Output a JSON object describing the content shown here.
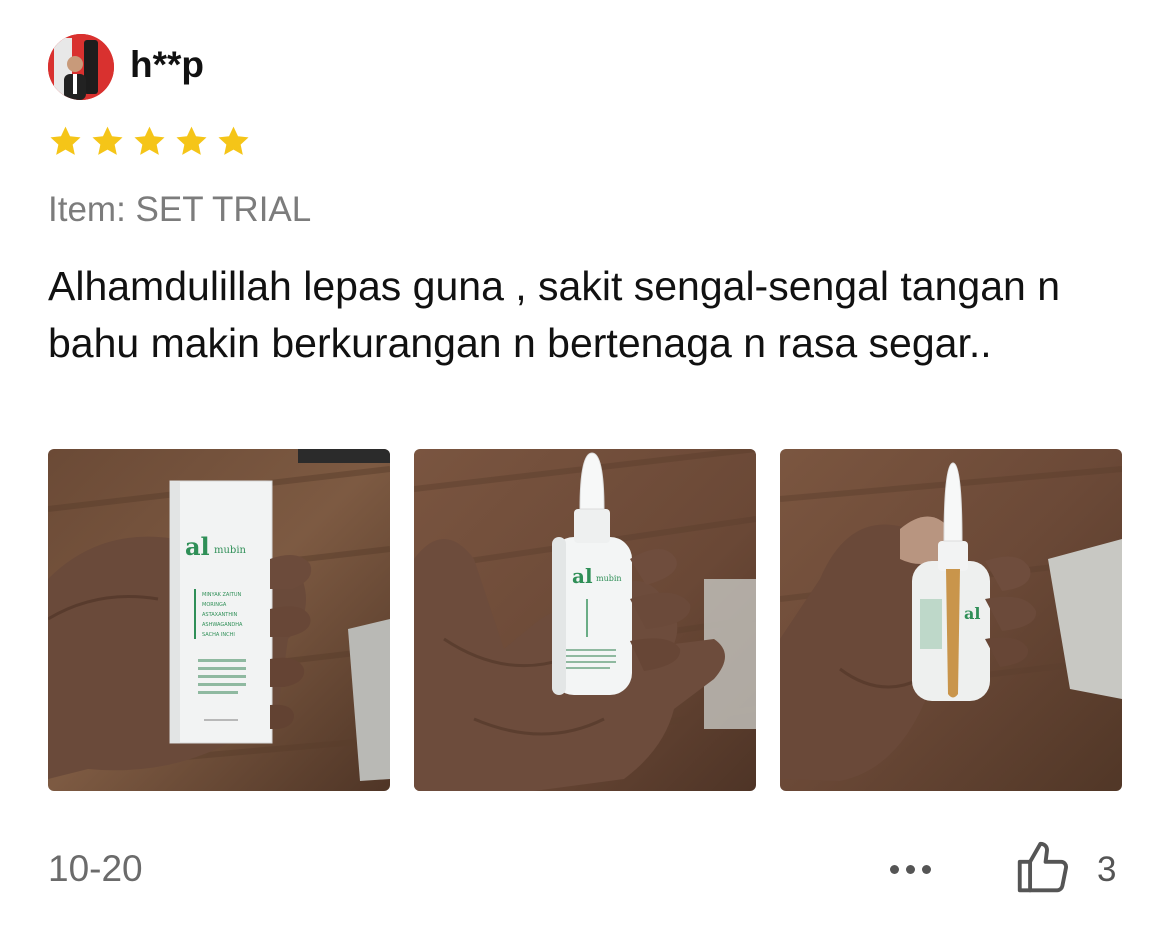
{
  "review": {
    "username": "h**p",
    "rating": 5,
    "rating_max": 5,
    "item_label": "Item: SET TRIAL",
    "text": "Alhamdulillah lepas guna , sakit sengal-sengal tangan n bahu makin berkurangan n bertenaga n rasa segar..",
    "date": "10-20",
    "like_count": "3"
  },
  "product": {
    "brand_mark": "al",
    "brand_name": "mubin",
    "ingredients": [
      "MINYAK ZAITUN",
      "MORINGA",
      "ASTAXANTHIN",
      "ASHWAGANDHA",
      "SACHA INCHI"
    ]
  },
  "colors": {
    "star": "#f5c518",
    "brand_green": "#2f8f57",
    "text": "#111111",
    "muted": "#7c7c7c"
  },
  "icons": {
    "avatar": "user-avatar-photo",
    "rating": "star-icon",
    "more": "more-dots-icon",
    "like": "thumbs-up-icon"
  }
}
